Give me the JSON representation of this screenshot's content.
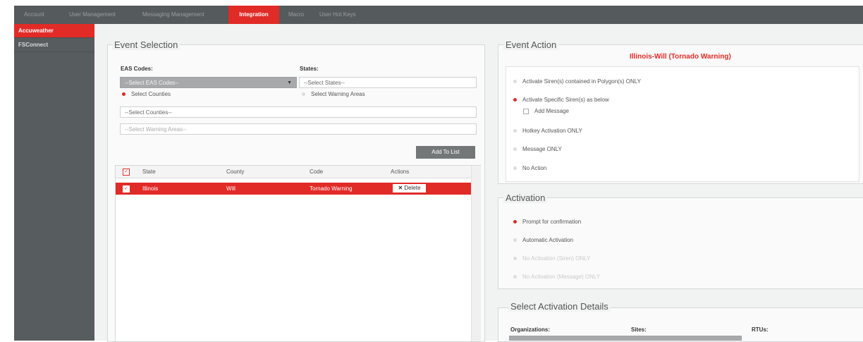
{
  "topnav": {
    "tabs": [
      {
        "label": "Account",
        "active": false
      },
      {
        "label": "User Management",
        "active": false
      },
      {
        "label": "Messaging Management",
        "active": false
      },
      {
        "label": "Integration",
        "active": true
      },
      {
        "label": "Macro",
        "active": false
      },
      {
        "label": "User Hot Keys",
        "active": false
      }
    ]
  },
  "sidebar": {
    "items": [
      {
        "label": "Accuweather",
        "active": true
      },
      {
        "label": "FSConnect",
        "active": false
      }
    ]
  },
  "event_selection": {
    "legend": "Event Selection",
    "eas_label": "EAS Codes:",
    "eas_value": "--Select EAS Codes--",
    "states_label": "States:",
    "states_value": "--Select States--",
    "radio_counties": "Select Counties",
    "radio_warning_areas": "Select Warning Areas",
    "counties_value": "--Select Counties--",
    "warning_areas_value": "--Select Warning Areas--",
    "add_button": "Add To List"
  },
  "table": {
    "headers": [
      "State",
      "County",
      "Code",
      "Actions"
    ],
    "rows": [
      {
        "state": "Illinois",
        "county": "Will",
        "code": "Tornado Warning",
        "action": "Delete"
      }
    ]
  },
  "event_action": {
    "legend": "Event Action",
    "title": "Illinois-Will (Tornado Warning)",
    "options": [
      "Activate Siren(s) contained in Polygon(s) ONLY",
      "Activate Specific Siren(s) as below",
      "Add Message",
      "Hotkey Activation ONLY",
      "Message ONLY",
      "No Action"
    ]
  },
  "activation": {
    "legend": "Activation",
    "options": [
      "Prompt for confirmation",
      "Automatic Activation",
      "No Activation (Siren) ONLY",
      "No Activation (Message) ONLY"
    ]
  },
  "details": {
    "legend": "Select Activation Details",
    "organizations_label": "Organizations:",
    "sites_label": "Sites:",
    "rtus_label": "RTUs:"
  },
  "colors": {
    "accent": "#e02b27",
    "nav": "#555a5c",
    "sidebar": "#575c5e"
  }
}
